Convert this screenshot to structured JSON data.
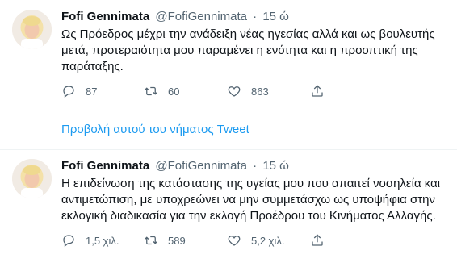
{
  "tweets": [
    {
      "author_name": "Fofi Gennimata",
      "handle": "@FofiGennimata",
      "separator": "·",
      "time": "15 ώ",
      "text": "Ως Πρόεδρος μέχρι την ανάδειξη νέας ηγεσίας αλλά και ως βουλευτής μετά, προτεραιότητα μου παραμένει η ενότητα και η προοπτική της παράταξης.",
      "replies": "87",
      "retweets": "60",
      "likes": "863",
      "show_thread": "Προβολή αυτού του νήματος Tweet"
    },
    {
      "author_name": "Fofi Gennimata",
      "handle": "@FofiGennimata",
      "separator": "·",
      "time": "15 ώ",
      "text": "Η επιδείνωση της κατάστασης της υγείας μου που απαιτεί νοσηλεία και αντιμετώπιση, με υποχρεώνει να μην συμμετάσχω ως υποψήφια στην εκλογική διαδικασία για την εκλογή Προέδρου του Κινήματος Αλλαγής.",
      "replies": "1,5 χιλ.",
      "retweets": "589",
      "likes": "5,2 χιλ."
    }
  ],
  "colors": {
    "link": "#1d9bf0",
    "secondary_text": "#536471",
    "primary_text": "#0f1419"
  },
  "icons": [
    "reply-icon",
    "retweet-icon",
    "like-icon",
    "share-icon"
  ]
}
